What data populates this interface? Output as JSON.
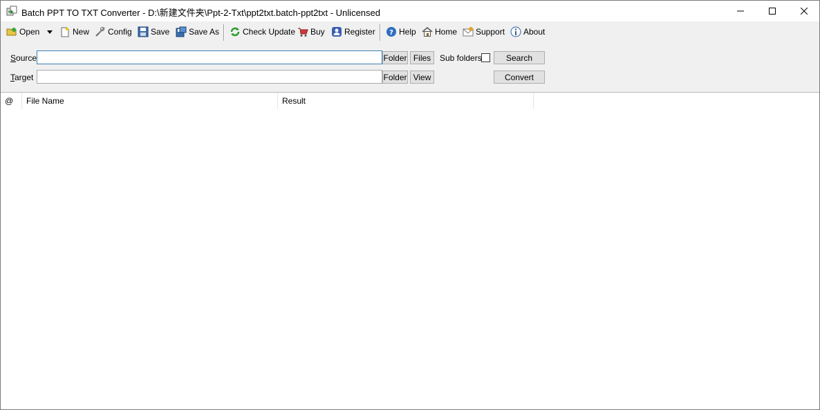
{
  "window": {
    "title": "Batch PPT TO TXT Converter - D:\\新建文件夹\\Ppt-2-Txt\\ppt2txt.batch-ppt2txt - Unlicensed"
  },
  "toolbar": {
    "open": "Open",
    "new": "New",
    "config": "Config",
    "save": "Save",
    "save_as": "Save As",
    "check_update": "Check Update",
    "buy": "Buy",
    "register": "Register",
    "help": "Help",
    "home": "Home",
    "support": "Support",
    "about": "About"
  },
  "form": {
    "source_label_accel": "S",
    "source_label_rest": "ource",
    "source_value": "",
    "target_label_accel": "T",
    "target_label_rest": "arget",
    "target_value": "",
    "folder_btn": "Folder",
    "files_btn": "Files",
    "subfolders_label": "Sub folders",
    "subfolders_checked": false,
    "search_btn": "Search",
    "target_folder_btn": "Folder",
    "view_btn": "View",
    "convert_btn": "Convert"
  },
  "list": {
    "columns": [
      "@",
      "File Name",
      "Result"
    ],
    "rows": []
  }
}
